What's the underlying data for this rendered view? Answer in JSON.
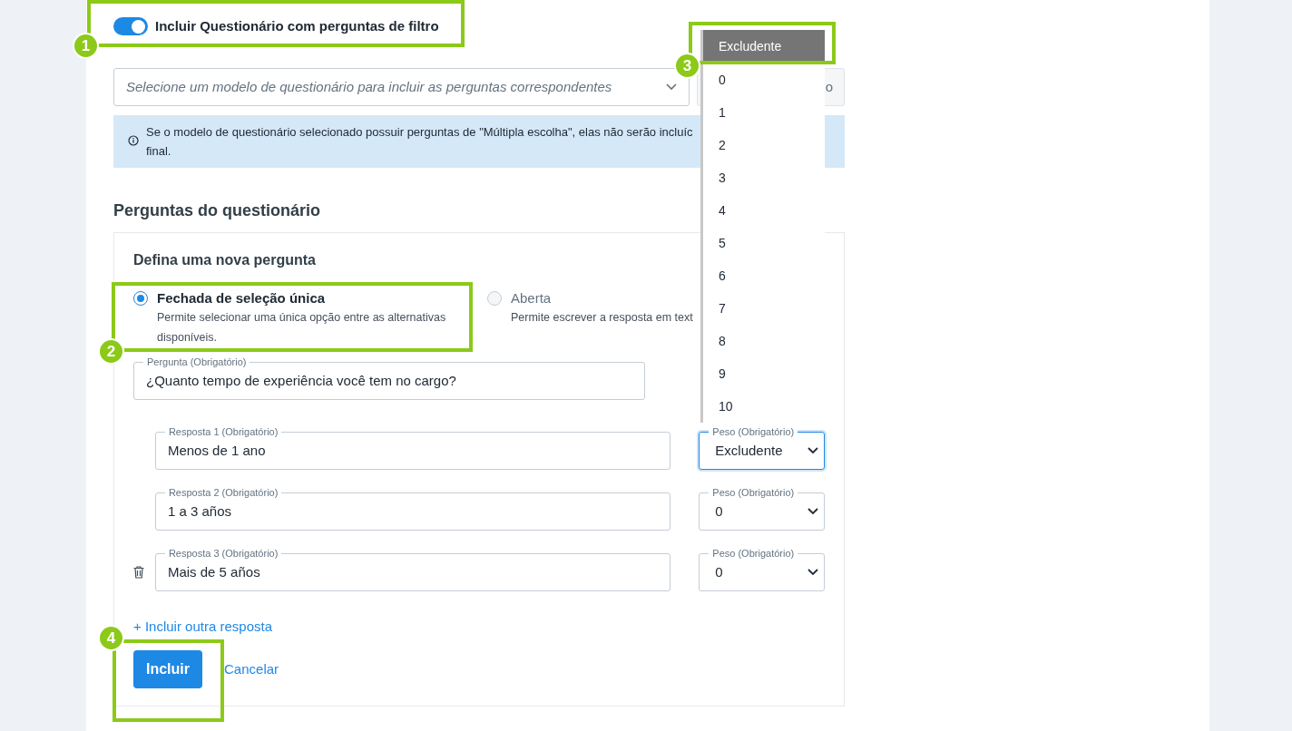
{
  "filter_toggle": {
    "label": "Incluir Questionário com perguntas de filtro",
    "on": true
  },
  "template_select": {
    "placeholder": "Selecione um modelo de questionário para incluir as perguntas correspondentes"
  },
  "template_button": {
    "label": "o"
  },
  "info_banner": {
    "lines": [
      "Se o modelo de questionário selecionado possuir perguntas de \"Múltipla escolha\", elas não serão incluíc",
      "final."
    ]
  },
  "section_title": "Perguntas do questionário",
  "question_card": {
    "title": "Defina uma nova pergunta",
    "question_types": [
      {
        "label": "Fechada de seleção única",
        "description": "Permite selecionar uma única opção entre as alternativas disponíveis.",
        "selected": true
      },
      {
        "label": "Aberta",
        "description": "Permite escrever a resposta em text",
        "selected": false
      }
    ],
    "question": {
      "label": "Pergunta (Obrigatório)",
      "value": "¿Quanto tempo de experiência você tem no cargo?"
    },
    "answers": [
      {
        "label": "Resposta 1 (Obrigatório)",
        "value": "Menos de 1 ano",
        "weight_label": "Peso (Obrigatório)",
        "weight": "Excludente",
        "focused": true,
        "deletable": false
      },
      {
        "label": "Resposta 2 (Obrigatório)",
        "value": "1 a 3 años",
        "weight_label": "Peso (Obrigatório)",
        "weight": "0",
        "focused": false,
        "deletable": false
      },
      {
        "label": "Resposta 3 (Obrigatório)",
        "value": "Mais de 5 años",
        "weight_label": "Peso (Obrigatório)",
        "weight": "0",
        "focused": false,
        "deletable": true
      }
    ],
    "add_answer_link": "+ Incluir outra resposta",
    "buttons": {
      "primary": "Incluir",
      "secondary": "Cancelar"
    }
  },
  "weight_dropdown": {
    "options": [
      {
        "label": "Excludente",
        "selected": true
      },
      {
        "label": "0",
        "selected": false
      },
      {
        "label": "1",
        "selected": false
      },
      {
        "label": "2",
        "selected": false
      },
      {
        "label": "3",
        "selected": false
      },
      {
        "label": "4",
        "selected": false
      },
      {
        "label": "5",
        "selected": false
      },
      {
        "label": "6",
        "selected": false
      },
      {
        "label": "7",
        "selected": false
      },
      {
        "label": "8",
        "selected": false
      },
      {
        "label": "9",
        "selected": false
      },
      {
        "label": "10",
        "selected": false
      }
    ]
  },
  "annotations": [
    {
      "number": "1"
    },
    {
      "number": "2"
    },
    {
      "number": "3"
    },
    {
      "number": "4"
    }
  ]
}
